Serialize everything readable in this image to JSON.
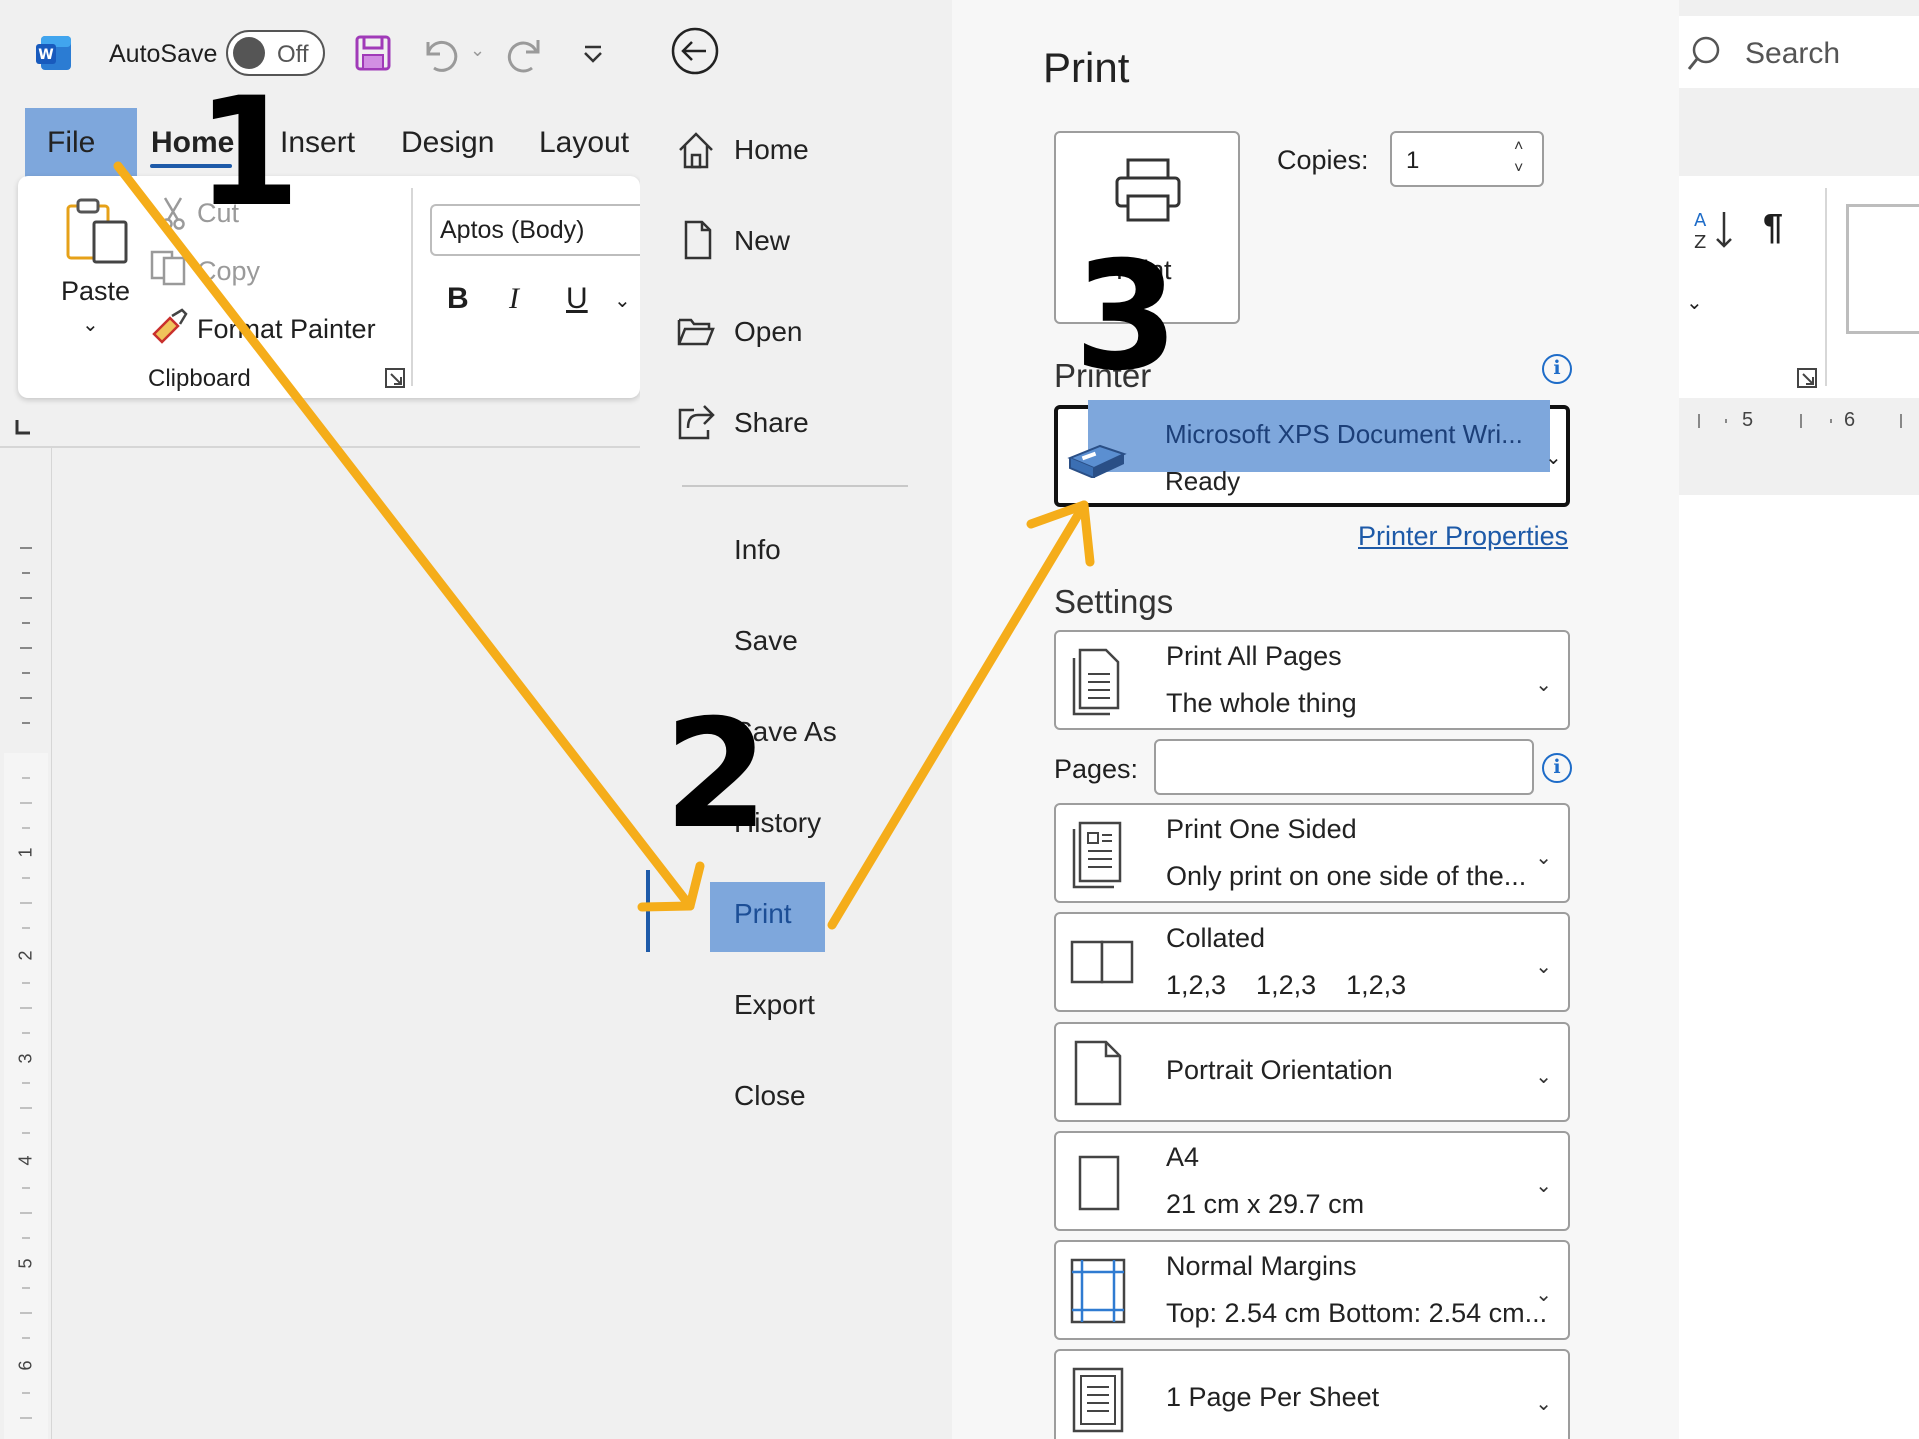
{
  "titlebar": {
    "autosave_label": "AutoSave",
    "autosave_state": "Off",
    "search_label": "Search"
  },
  "ribbon": {
    "tabs": [
      "File",
      "Home",
      "Insert",
      "Design",
      "Layout"
    ],
    "clipboard": {
      "paste": "Paste",
      "cut": "Cut",
      "copy": "Copy",
      "format_painter": "Format Painter",
      "group_label": "Clipboard"
    },
    "font": {
      "name": "Aptos (Body)",
      "bold": "B",
      "italic": "I",
      "underline": "U"
    },
    "paragraph_mark": "¶"
  },
  "ruler": {
    "vertical_numbers": [
      "1",
      "2",
      "3",
      "4",
      "5",
      "6"
    ],
    "horizontal_numbers": [
      "5",
      "6"
    ]
  },
  "backstage": {
    "nav": [
      {
        "label": "Home",
        "icon": "home-icon"
      },
      {
        "label": "New",
        "icon": "new-document-icon"
      },
      {
        "label": "Open",
        "icon": "open-folder-icon"
      },
      {
        "label": "Share",
        "icon": "share-icon"
      }
    ],
    "nav2": [
      "Info",
      "Save",
      "Save As",
      "History",
      "Print",
      "Export",
      "Close"
    ],
    "selected": "Print"
  },
  "print_panel": {
    "title": "Print",
    "print_button_label": "Print",
    "copies_label": "Copies:",
    "copies_value": "1",
    "printer_heading": "Printer",
    "printer_name": "Microsoft XPS Document Wri...",
    "printer_status": "Ready",
    "printer_properties": "Printer Properties",
    "settings_heading": "Settings",
    "pages_label": "Pages:",
    "settings": [
      {
        "line1": "Print All Pages",
        "line2": "The whole thing",
        "icon": "pages-icon"
      },
      {
        "line1": "Print One Sided",
        "line2": "Only print on one side of the...",
        "icon": "one-sided-icon"
      },
      {
        "line1": "Collated",
        "line2": "1,2,3    1,2,3    1,2,3",
        "icon": "collated-icon"
      },
      {
        "line1": "Portrait Orientation",
        "line2": "",
        "icon": "portrait-icon"
      },
      {
        "line1": "A4",
        "line2": "21 cm x 29.7 cm",
        "icon": "paper-size-icon"
      },
      {
        "line1": "Normal Margins",
        "line2": "Top: 2.54 cm Bottom: 2.54 cm...",
        "icon": "margins-icon"
      },
      {
        "line1": "1 Page Per Sheet",
        "line2": "",
        "icon": "pages-per-sheet-icon"
      }
    ]
  },
  "annotations": {
    "step1": "1",
    "step2": "2",
    "step3": "3",
    "arrow_color": "#f5ad1a",
    "highlight_color": "#7ea7dc"
  }
}
